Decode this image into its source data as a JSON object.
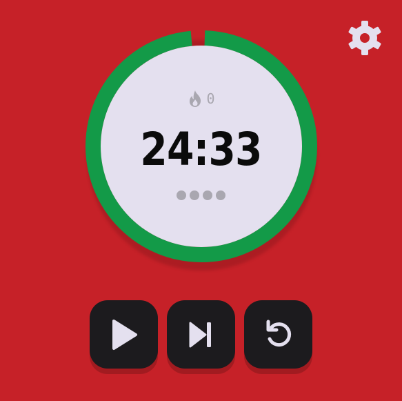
{
  "timer": {
    "time_remaining": "24:33",
    "progress_fraction": 0.98,
    "streak_count": "0",
    "sessions_total": 4,
    "sessions_completed": 0
  },
  "colors": {
    "background": "#c62128",
    "ring_progress": "#139a48",
    "face": "#e4e0ef",
    "muted": "#a9a7b0",
    "button": "#1c1b1e",
    "button_icon": "#e4e0ef"
  },
  "icons": {
    "settings": "gear-icon",
    "streak": "flame-icon",
    "play": "play-icon",
    "skip": "skip-next-icon",
    "reset": "reset-icon"
  }
}
